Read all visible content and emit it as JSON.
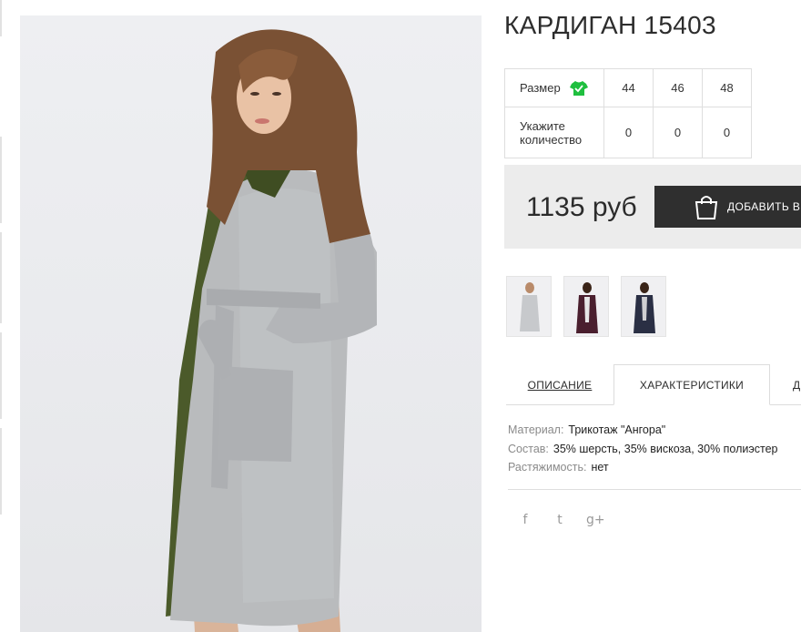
{
  "product": {
    "title": "КАРДИГАН 15403"
  },
  "size_table": {
    "size_label": "Размер",
    "sizes": [
      "44",
      "46",
      "48"
    ],
    "quantity_label": "Укажите количество",
    "quantities": [
      "0",
      "0",
      "0"
    ]
  },
  "price_box": {
    "price": "1135 руб",
    "add_button_label": "ДОБАВИТЬ В"
  },
  "thumbnails": [
    {
      "color": "#c9c9cc"
    },
    {
      "color": "#4a1f2e"
    },
    {
      "color": "#2a2f44"
    }
  ],
  "tabs": [
    {
      "label": "ОПИСАНИЕ"
    },
    {
      "label": "ХАРАКТЕРИСТИКИ"
    },
    {
      "label": "Д"
    }
  ],
  "specs": [
    {
      "key": "Материал:",
      "value": "Трикотаж \"Ангора\""
    },
    {
      "key": "Состав:",
      "value": "35% шерсть, 35% вискоза, 30% полиэстер"
    },
    {
      "key": "Растяжимость:",
      "value": "нет"
    }
  ],
  "social": {
    "facebook": "f",
    "twitter": "t",
    "googleplus": "g+"
  },
  "colors": {
    "size_icon": "#1fbf3f",
    "button_bg": "#2f2f2f",
    "price_bg": "#ececec"
  }
}
